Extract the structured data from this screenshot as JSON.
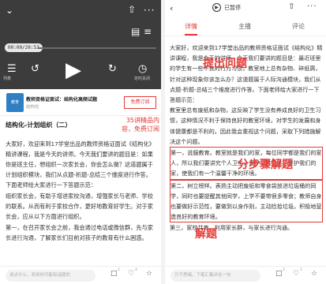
{
  "left": {
    "player": {
      "time": "00:00/20:53",
      "progress": 0.0,
      "list_label": "列表",
      "timer_label": "定时关闭"
    },
    "course": {
      "thumb_text": "教育",
      "title": "教师资格证面试：结构化高频试题",
      "subtitle": "结构化",
      "subscribe": "免费订阅"
    },
    "section_title": "结构化-计划组织（二）",
    "callout": "35讲精品内容，免费订阅",
    "body": [
      "大家好，欢迎来到17学堂出品的教师资格证面试《结构化》精讲课程，我是今天的讲师。今天我们要讲的题目是：如果你是班主任，想组织一次家长会，你会怎么做？这道题属于计划组织模块，我们从点题-析题-总结三个维度进行作答。下面老师给大家进行一下答题示范：",
      "组织家长会，有助于增进家校沟通，增强家长与老师、学校的联系。从而有利于家校合作，更好地教育好学生。对于家长会，应从以下方面进行组织。",
      "第一，在召开家长会之前，我会通过电话或微信群，先与家长进行沟通，了解家长们目前对孩子的教育有什么困惑。"
    ],
    "comment_placeholder": "说点什么，发到你可能有话题的",
    "like_count": "4",
    "comment_count": "2"
  },
  "right": {
    "status": "已暂停",
    "tabs": [
      "详情",
      "主播",
      "评论"
    ],
    "active_tab": 0,
    "callouts": [
      "提出问题",
      "分步骤解题",
      "解题"
    ],
    "body": [
      "大家好，欢迎来到17学堂出品的教师资格证面试《结构化》精讲课程，我是今天的讲师。今天我们要讲的题目是：最近班里的学生有一些不良的行为习惯，教室地上总有杂物、碎纸屑，针对这种现象你该怎么办？这道题属于人际沟通模块，我们从点题-析题-总结三个维度进行作答。下面老师给大家进行一下答题示范：",
      "教室里总有废纸和杂物，这反映了学生没有养成良好的卫生习惯，这种情况不利于保持良好的教室环境，对学生的发展和身体健康都是不利的。因此我会重视这个问题，采取下列措施解决这个问题。",
      "第一，说服教育。教室就是我们的家，每位同学都是我们的家人，所以我们要讲究个人卫生，爱护公共卫生，爱护我们的家，使我们有一个温馨干净的环境。",
      "第二，树立榜样。表扬主动把废纸和零食袋放进垃圾桶的同学，同时也要提醒其他同学，上学不要带很多零食；教师自身也要做好示范性，要做到以身作则，主动捡拾垃圾，积极地营造良好的教育环境。",
      "第三，家校共育。利用家长群，与家长进行沟通。"
    ],
    "comment_placeholder": "万千思绪，下笔汇集评论一句",
    "like_count": "1",
    "comment_count": "2"
  }
}
